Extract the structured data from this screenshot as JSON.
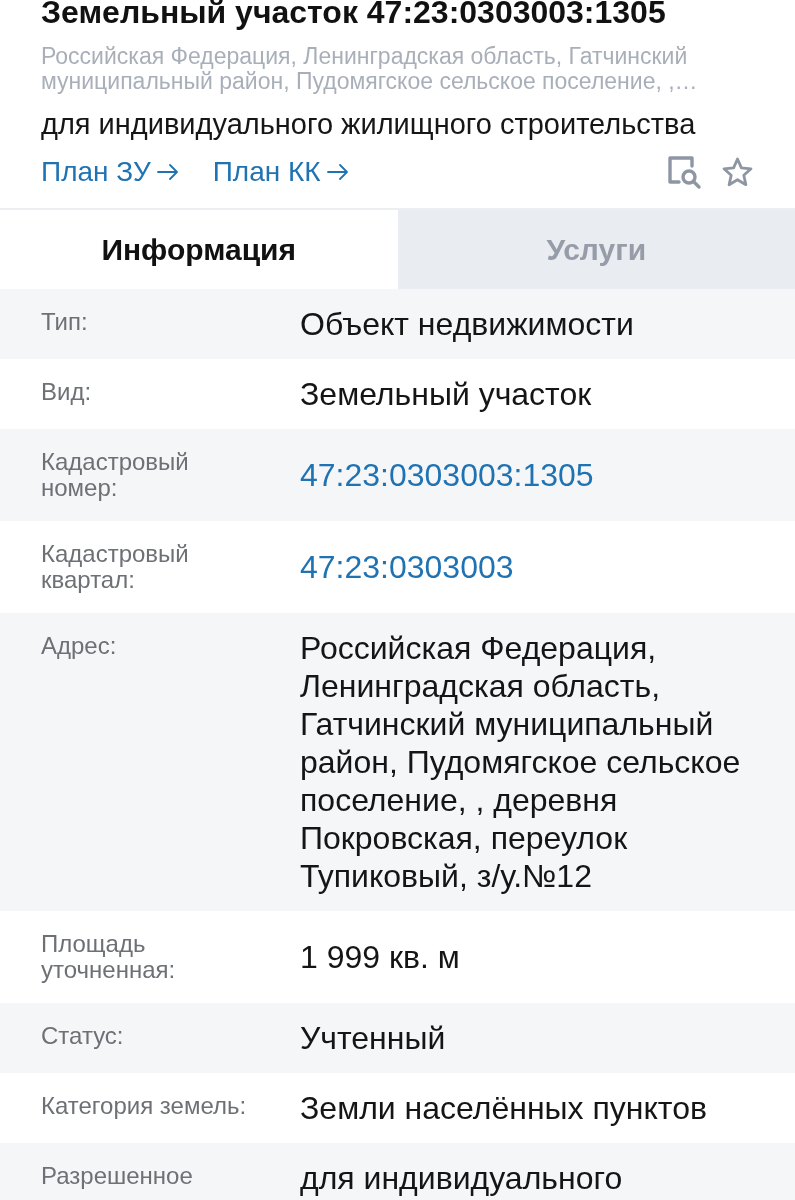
{
  "header": {
    "title": "Земельный участок 47:23:0303003:1305",
    "address": "Российская Федерация, Ленинградская область, Гатчинский муниципальный район, Пудомягское сельское поселение, ,…",
    "purpose": "для индивидуального жилищного строительства",
    "links": [
      "План ЗУ",
      "План КК"
    ]
  },
  "tabs": [
    {
      "label": "Информация",
      "selected": true
    },
    {
      "label": "Услуги",
      "selected": false
    }
  ],
  "details": [
    {
      "label": "Тип:",
      "value": "Объект недвижимости",
      "kind": "text"
    },
    {
      "label": "Вид:",
      "value": "Земельный участок",
      "kind": "text"
    },
    {
      "label": "Кадастровый номер:",
      "value": "47:23:0303003:1305",
      "kind": "link"
    },
    {
      "label": "Кадастровый квартал:",
      "value": "47:23:0303003",
      "kind": "link"
    },
    {
      "label": "Адрес:",
      "value": "Российская Федерация, Ленинградская область, Гатчинский муниципальный район, Пудомягское сельское поселение, , деревня Покровская, переулок Тупиковый, з/у.№12",
      "kind": "text"
    },
    {
      "label": "Площадь уточненная:",
      "value": "1 999 кв. м",
      "kind": "text"
    },
    {
      "label": "Статус:",
      "value": "Учтенный",
      "kind": "text"
    },
    {
      "label": "Категория земель:",
      "value": "Земли населённых пунктов",
      "kind": "text"
    },
    {
      "label": "Разрешенное",
      "value": "для индивидуального",
      "kind": "text"
    }
  ]
}
